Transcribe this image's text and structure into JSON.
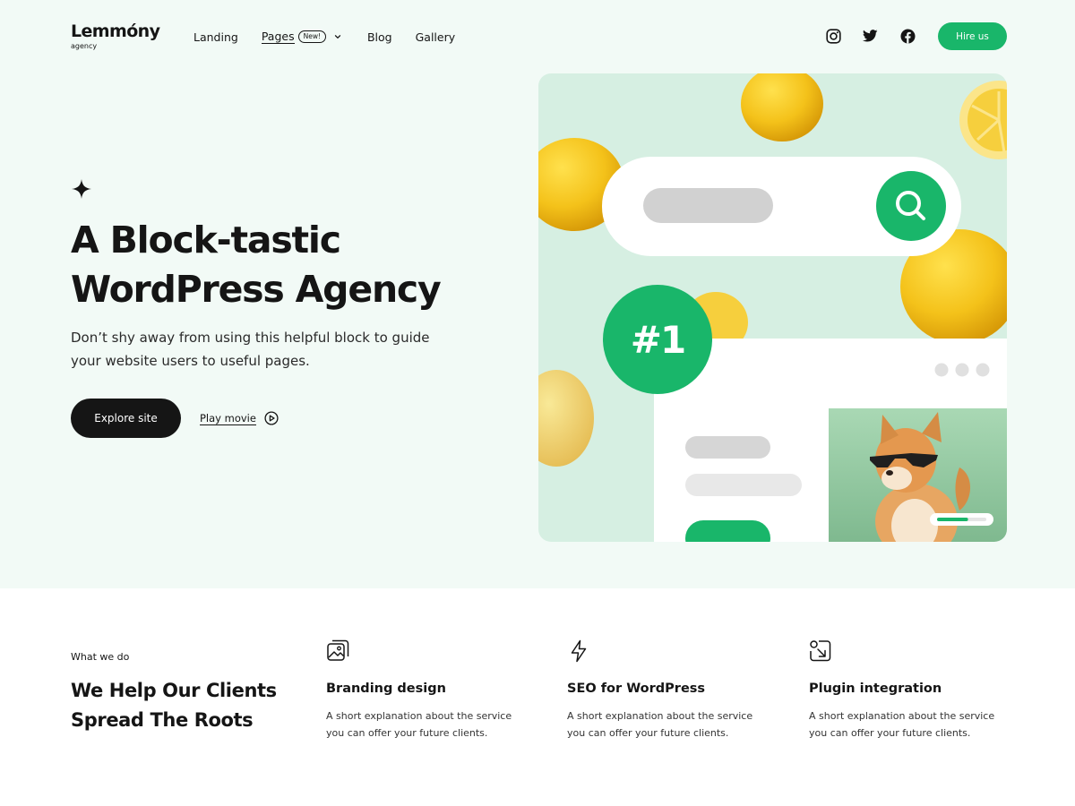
{
  "header": {
    "logo_name": "Lemmóny",
    "logo_sub": "agency",
    "nav": {
      "landing": "Landing",
      "pages": "Pages",
      "pages_badge": "New!",
      "blog": "Blog",
      "gallery": "Gallery"
    },
    "social_icons": [
      "instagram-icon",
      "twitter-icon",
      "facebook-icon"
    ],
    "hire_label": "Hire us"
  },
  "hero": {
    "headline_line1": "A Block-tastic",
    "headline_line2": "WordPress Agency",
    "lead": "Don’t shy away from using this helpful block to guide your website users to useful pages.",
    "explore_label": "Explore site",
    "play_label": "Play movie",
    "rank_label": "#1",
    "progress": 0.63
  },
  "services": {
    "eyebrow": "What we do",
    "title_line1": "We Help Our Clients",
    "title_line2": "Spread The Roots",
    "items": [
      {
        "icon": "image-icon",
        "title": "Branding design",
        "desc": "A short explanation about the service you can offer your future clients."
      },
      {
        "icon": "lightning-icon",
        "title": "SEO for WordPress",
        "desc": "A short explanation about the service you can offer your future clients."
      },
      {
        "icon": "arrow-in-box-icon",
        "title": "Plugin integration",
        "desc": "A short explanation about the service you can offer your future clients."
      }
    ]
  },
  "colors": {
    "accent": "#19b66a",
    "hero_background": "#f2faf6",
    "dark": "#151515"
  }
}
